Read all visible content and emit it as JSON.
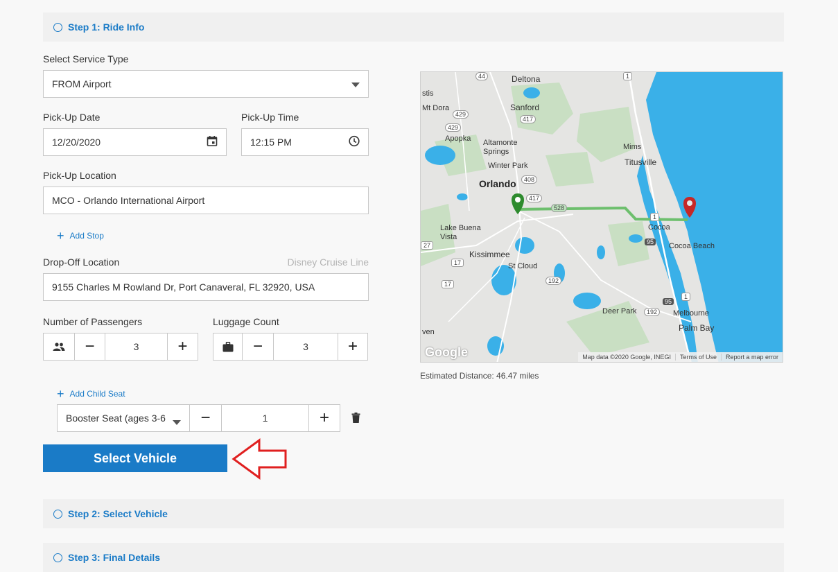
{
  "steps": [
    {
      "label": "Step 1: Ride Info"
    },
    {
      "label": "Step 2: Select Vehicle"
    },
    {
      "label": "Step 3: Final Details"
    }
  ],
  "service_type": {
    "label": "Select Service Type",
    "value": "FROM Airport"
  },
  "pickup_date": {
    "label": "Pick-Up Date",
    "value": "12/20/2020"
  },
  "pickup_time": {
    "label": "Pick-Up Time",
    "value": "12:15 PM"
  },
  "pickup_location": {
    "label": "Pick-Up Location",
    "value": "MCO - Orlando International Airport"
  },
  "add_stop": {
    "label": "Add Stop"
  },
  "dropoff": {
    "label": "Drop-Off Location",
    "hint": "Disney Cruise Line",
    "value": "9155 Charles M Rowland Dr, Port Canaveral, FL 32920, USA"
  },
  "passengers": {
    "label": "Number of Passengers",
    "value": "3"
  },
  "luggage": {
    "label": "Luggage Count",
    "value": "3"
  },
  "child_seat": {
    "add_label": "Add Child Seat",
    "seat_type": "Booster Seat (ages 3-6",
    "value": "1"
  },
  "select_vehicle": {
    "label": "Select Vehicle"
  },
  "map": {
    "places": [
      "Deltona",
      "Sanford",
      "Apopka",
      "Altamonte Springs",
      "Winter Park",
      "Orlando",
      "Mims",
      "Titusville",
      "Lake Buena Vista",
      "Kissimmee",
      "St Cloud",
      "Cocoa",
      "Cocoa Beach",
      "Deer Park",
      "Melbourne",
      "Palm Bay",
      "Mt Dora",
      "Kissimmee",
      "stis",
      "ven"
    ],
    "shields": [
      "44",
      "429",
      "429",
      "417",
      "417",
      "408",
      "528",
      "1",
      "95",
      "1",
      "17",
      "27",
      "17",
      "192",
      "192",
      "95",
      "1",
      "1"
    ],
    "attribution": {
      "logo": "Google",
      "map_data": "Map data ©2020 Google, INEGI",
      "terms": "Terms of Use",
      "report": "Report a map error"
    }
  },
  "estimated_distance": "Estimated Distance: 46.47 miles",
  "colors": {
    "accent": "#1a7bc7",
    "route": "#6dbf6d",
    "origin_pin": "#2e8b2e",
    "dest_pin": "#c62828",
    "water": "#3ab0e8"
  }
}
